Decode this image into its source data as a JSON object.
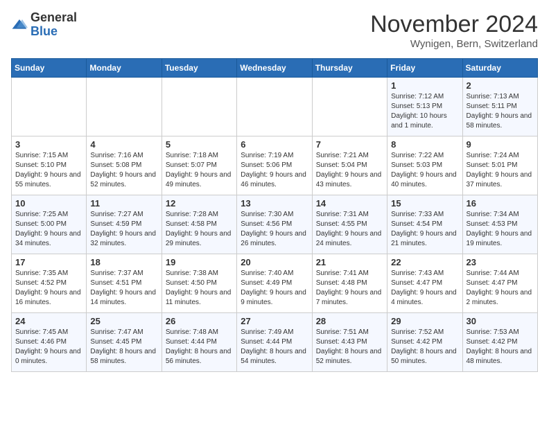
{
  "logo": {
    "general": "General",
    "blue": "Blue"
  },
  "title": "November 2024",
  "location": "Wynigen, Bern, Switzerland",
  "days_of_week": [
    "Sunday",
    "Monday",
    "Tuesday",
    "Wednesday",
    "Thursday",
    "Friday",
    "Saturday"
  ],
  "weeks": [
    [
      {
        "day": "",
        "info": ""
      },
      {
        "day": "",
        "info": ""
      },
      {
        "day": "",
        "info": ""
      },
      {
        "day": "",
        "info": ""
      },
      {
        "day": "",
        "info": ""
      },
      {
        "day": "1",
        "info": "Sunrise: 7:12 AM\nSunset: 5:13 PM\nDaylight: 10 hours and 1 minute."
      },
      {
        "day": "2",
        "info": "Sunrise: 7:13 AM\nSunset: 5:11 PM\nDaylight: 9 hours and 58 minutes."
      }
    ],
    [
      {
        "day": "3",
        "info": "Sunrise: 7:15 AM\nSunset: 5:10 PM\nDaylight: 9 hours and 55 minutes."
      },
      {
        "day": "4",
        "info": "Sunrise: 7:16 AM\nSunset: 5:08 PM\nDaylight: 9 hours and 52 minutes."
      },
      {
        "day": "5",
        "info": "Sunrise: 7:18 AM\nSunset: 5:07 PM\nDaylight: 9 hours and 49 minutes."
      },
      {
        "day": "6",
        "info": "Sunrise: 7:19 AM\nSunset: 5:06 PM\nDaylight: 9 hours and 46 minutes."
      },
      {
        "day": "7",
        "info": "Sunrise: 7:21 AM\nSunset: 5:04 PM\nDaylight: 9 hours and 43 minutes."
      },
      {
        "day": "8",
        "info": "Sunrise: 7:22 AM\nSunset: 5:03 PM\nDaylight: 9 hours and 40 minutes."
      },
      {
        "day": "9",
        "info": "Sunrise: 7:24 AM\nSunset: 5:01 PM\nDaylight: 9 hours and 37 minutes."
      }
    ],
    [
      {
        "day": "10",
        "info": "Sunrise: 7:25 AM\nSunset: 5:00 PM\nDaylight: 9 hours and 34 minutes."
      },
      {
        "day": "11",
        "info": "Sunrise: 7:27 AM\nSunset: 4:59 PM\nDaylight: 9 hours and 32 minutes."
      },
      {
        "day": "12",
        "info": "Sunrise: 7:28 AM\nSunset: 4:58 PM\nDaylight: 9 hours and 29 minutes."
      },
      {
        "day": "13",
        "info": "Sunrise: 7:30 AM\nSunset: 4:56 PM\nDaylight: 9 hours and 26 minutes."
      },
      {
        "day": "14",
        "info": "Sunrise: 7:31 AM\nSunset: 4:55 PM\nDaylight: 9 hours and 24 minutes."
      },
      {
        "day": "15",
        "info": "Sunrise: 7:33 AM\nSunset: 4:54 PM\nDaylight: 9 hours and 21 minutes."
      },
      {
        "day": "16",
        "info": "Sunrise: 7:34 AM\nSunset: 4:53 PM\nDaylight: 9 hours and 19 minutes."
      }
    ],
    [
      {
        "day": "17",
        "info": "Sunrise: 7:35 AM\nSunset: 4:52 PM\nDaylight: 9 hours and 16 minutes."
      },
      {
        "day": "18",
        "info": "Sunrise: 7:37 AM\nSunset: 4:51 PM\nDaylight: 9 hours and 14 minutes."
      },
      {
        "day": "19",
        "info": "Sunrise: 7:38 AM\nSunset: 4:50 PM\nDaylight: 9 hours and 11 minutes."
      },
      {
        "day": "20",
        "info": "Sunrise: 7:40 AM\nSunset: 4:49 PM\nDaylight: 9 hours and 9 minutes."
      },
      {
        "day": "21",
        "info": "Sunrise: 7:41 AM\nSunset: 4:48 PM\nDaylight: 9 hours and 7 minutes."
      },
      {
        "day": "22",
        "info": "Sunrise: 7:43 AM\nSunset: 4:47 PM\nDaylight: 9 hours and 4 minutes."
      },
      {
        "day": "23",
        "info": "Sunrise: 7:44 AM\nSunset: 4:47 PM\nDaylight: 9 hours and 2 minutes."
      }
    ],
    [
      {
        "day": "24",
        "info": "Sunrise: 7:45 AM\nSunset: 4:46 PM\nDaylight: 9 hours and 0 minutes."
      },
      {
        "day": "25",
        "info": "Sunrise: 7:47 AM\nSunset: 4:45 PM\nDaylight: 8 hours and 58 minutes."
      },
      {
        "day": "26",
        "info": "Sunrise: 7:48 AM\nSunset: 4:44 PM\nDaylight: 8 hours and 56 minutes."
      },
      {
        "day": "27",
        "info": "Sunrise: 7:49 AM\nSunset: 4:44 PM\nDaylight: 8 hours and 54 minutes."
      },
      {
        "day": "28",
        "info": "Sunrise: 7:51 AM\nSunset: 4:43 PM\nDaylight: 8 hours and 52 minutes."
      },
      {
        "day": "29",
        "info": "Sunrise: 7:52 AM\nSunset: 4:42 PM\nDaylight: 8 hours and 50 minutes."
      },
      {
        "day": "30",
        "info": "Sunrise: 7:53 AM\nSunset: 4:42 PM\nDaylight: 8 hours and 48 minutes."
      }
    ]
  ]
}
